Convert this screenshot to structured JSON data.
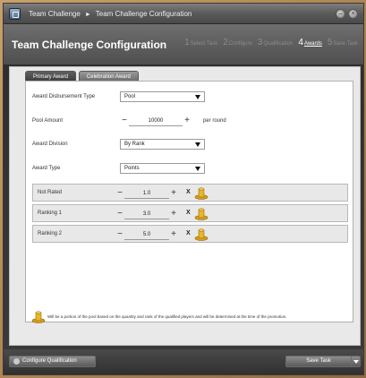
{
  "titlebar": {
    "crumb_root": "Team Challenge",
    "crumb_sep": "►",
    "crumb_current": "Team Challenge Configuration",
    "minimize_glyph": "–",
    "close_glyph": "×"
  },
  "header": {
    "title": "Team Challenge Configuration",
    "steps": [
      {
        "num": "1",
        "label": "Select Task",
        "active": false
      },
      {
        "num": "2",
        "label": "Configure",
        "active": false
      },
      {
        "num": "3",
        "label": "Qualification",
        "active": false
      },
      {
        "num": "4",
        "label": "Awards",
        "active": true
      },
      {
        "num": "5",
        "label": "Save Task",
        "active": false
      }
    ]
  },
  "tabs": [
    {
      "label": "Primary Award",
      "active": true
    },
    {
      "label": "Celebration Award",
      "active": false
    }
  ],
  "form": {
    "disbursement": {
      "label": "Award Disbursement Type",
      "value": "Pool"
    },
    "pool_amount": {
      "label": "Pool Amount",
      "minus": "−",
      "value": "10000",
      "plus": "+",
      "suffix": "per round"
    },
    "division": {
      "label": "Award Division",
      "value": "By Rank"
    },
    "type": {
      "label": "Award Type",
      "value": "Points"
    }
  },
  "ranks": [
    {
      "label": "Not Rated",
      "value": "1.0",
      "x": "X"
    },
    {
      "label": "Ranking 1",
      "value": "3.0",
      "x": "X"
    },
    {
      "label": "Ranking 2",
      "value": "5.0",
      "x": "X"
    }
  ],
  "stepper_glyphs": {
    "minus": "−",
    "plus": "+"
  },
  "footnote": "Will be a portion of the pool based on the quantity and rank of the qualified players and will be determined at the time of the promotion.",
  "bottom": {
    "left_button": "Configure Qualification",
    "right_button": "Save Task"
  }
}
